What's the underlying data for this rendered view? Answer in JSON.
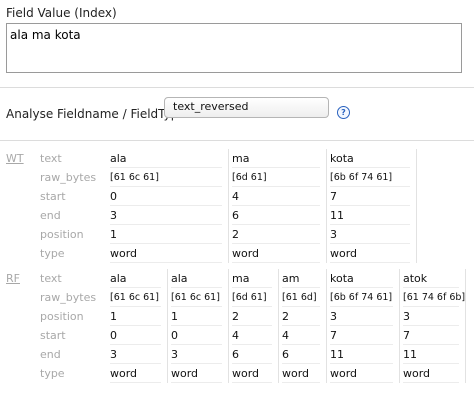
{
  "field_value": {
    "label": "Field Value (Index)",
    "value": "ala ma kota"
  },
  "analyse": {
    "label": "Analyse Fieldname / FieldType:",
    "selected": "text_reversed",
    "help_icon": "help-icon"
  },
  "wt": {
    "label": "WT",
    "row_labels": [
      "text",
      "raw_bytes",
      "start",
      "end",
      "position",
      "type"
    ],
    "tokens": [
      {
        "text": "ala",
        "raw_bytes": "[61 6c 61]",
        "start": "0",
        "end": "3",
        "position": "1",
        "type": "word"
      },
      {
        "text": "ma",
        "raw_bytes": "[6d 61]",
        "start": "4",
        "end": "6",
        "position": "2",
        "type": "word"
      },
      {
        "text": "kota",
        "raw_bytes": "[6b 6f 74 61]",
        "start": "7",
        "end": "11",
        "position": "3",
        "type": "word"
      }
    ]
  },
  "rf": {
    "label": "RF",
    "row_labels": [
      "text",
      "raw_bytes",
      "position",
      "start",
      "end",
      "type"
    ],
    "tokens": [
      {
        "text": "ala",
        "raw_bytes": "[61 6c 61]",
        "position": "1",
        "start": "0",
        "end": "3",
        "type": "word"
      },
      {
        "text": "ala",
        "raw_bytes": "[61 6c 61]",
        "position": "1",
        "start": "0",
        "end": "3",
        "type": "word"
      },
      {
        "text": "ma",
        "raw_bytes": "[6d 61]",
        "position": "2",
        "start": "4",
        "end": "6",
        "type": "word"
      },
      {
        "text": "am",
        "raw_bytes": "[61 6d]",
        "position": "2",
        "start": "4",
        "end": "6",
        "type": "word"
      },
      {
        "text": "kota",
        "raw_bytes": "[6b 6f 74 61]",
        "position": "3",
        "start": "7",
        "end": "11",
        "type": "word"
      },
      {
        "text": "atok",
        "raw_bytes": "[61 74 6f 6b]",
        "position": "3",
        "start": "7",
        "end": "11",
        "type": "word"
      }
    ]
  }
}
